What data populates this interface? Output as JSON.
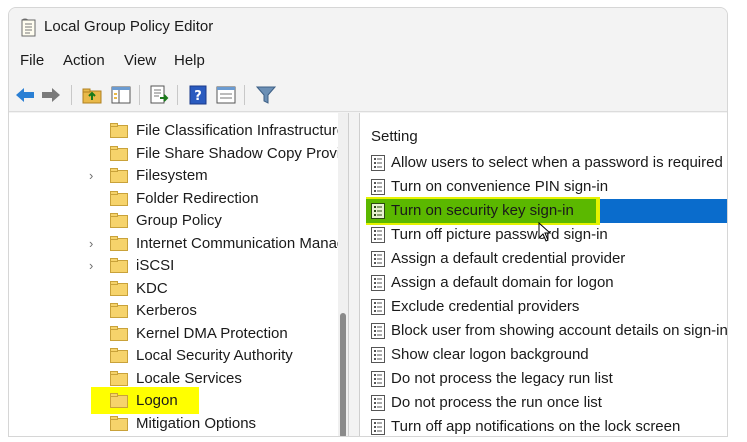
{
  "window": {
    "title": "Local Group Policy Editor"
  },
  "menu": [
    "File",
    "Action",
    "View",
    "Help"
  ],
  "toolbar": {
    "buttons": [
      "back-icon",
      "forward-icon",
      "up-folder-icon",
      "show-tree-icon",
      "export-list-icon",
      "help-icon",
      "properties-icon",
      "filter-icon"
    ]
  },
  "tree": {
    "items": [
      {
        "label": "File Classification Infrastructure",
        "chevron": ""
      },
      {
        "label": "File Share Shadow Copy Provider",
        "chevron": ""
      },
      {
        "label": "Filesystem",
        "chevron": "›"
      },
      {
        "label": "Folder Redirection",
        "chevron": ""
      },
      {
        "label": "Group Policy",
        "chevron": ""
      },
      {
        "label": "Internet Communication Management",
        "chevron": "›"
      },
      {
        "label": "iSCSI",
        "chevron": "›"
      },
      {
        "label": "KDC",
        "chevron": ""
      },
      {
        "label": "Kerberos",
        "chevron": ""
      },
      {
        "label": "Kernel DMA Protection",
        "chevron": ""
      },
      {
        "label": "Local Security Authority",
        "chevron": ""
      },
      {
        "label": "Locale Services",
        "chevron": ""
      },
      {
        "label": "Logon",
        "chevron": ""
      },
      {
        "label": "Mitigation Options",
        "chevron": ""
      }
    ]
  },
  "settings": {
    "header": "Setting",
    "items": [
      "Allow users to select when a password is required when resuming from connected standby",
      "Turn on convenience PIN sign-in",
      "Turn on security key sign-in",
      "Turn off picture password sign-in",
      "Assign a default credential provider",
      "Assign a default domain for logon",
      "Exclude credential providers",
      "Block user from showing account details on sign-in",
      "Show clear logon background",
      "Do not process the legacy run list",
      "Do not process the run once list",
      "Turn off app notifications on the lock screen"
    ]
  },
  "colors": {
    "selection": "#0a6ccc",
    "highlight": "#ffff00",
    "highlight_green": "#5bb800"
  }
}
